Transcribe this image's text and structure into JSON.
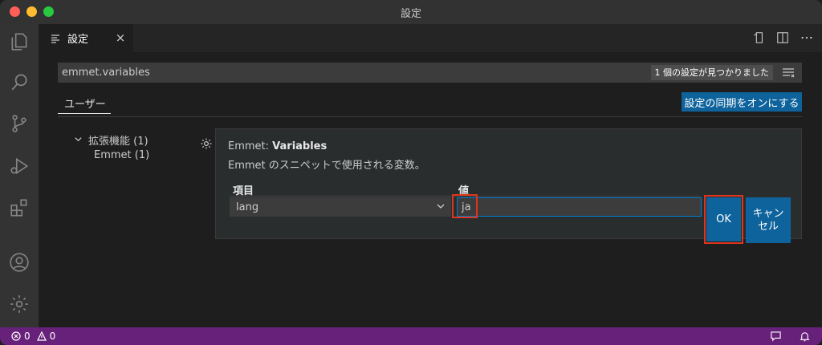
{
  "window": {
    "title": "設定"
  },
  "tab": {
    "label": "設定",
    "close": "×"
  },
  "search": {
    "value": "emmet.variables",
    "result_count": "1 個の設定が見つかりました"
  },
  "scope_tab": {
    "label": "ユーザー"
  },
  "sync_button": {
    "label": "設定の同期をオンにする"
  },
  "tree": {
    "category": "拡張機能 (1)",
    "subcategory": "Emmet (1)"
  },
  "setting": {
    "category": "Emmet: ",
    "name": "Variables",
    "description": "Emmet のスニペットで使用される変数。",
    "col_item": "項目",
    "col_value": "値",
    "item_value": "lang",
    "value_value": "ja"
  },
  "buttons": {
    "ok": "OK",
    "cancel": "キャンセル"
  },
  "status": {
    "errors": "0",
    "warnings": "0"
  },
  "colors": {
    "accent": "#0e639c",
    "statusbar": "#68217a",
    "highlight": "#e0341c"
  }
}
